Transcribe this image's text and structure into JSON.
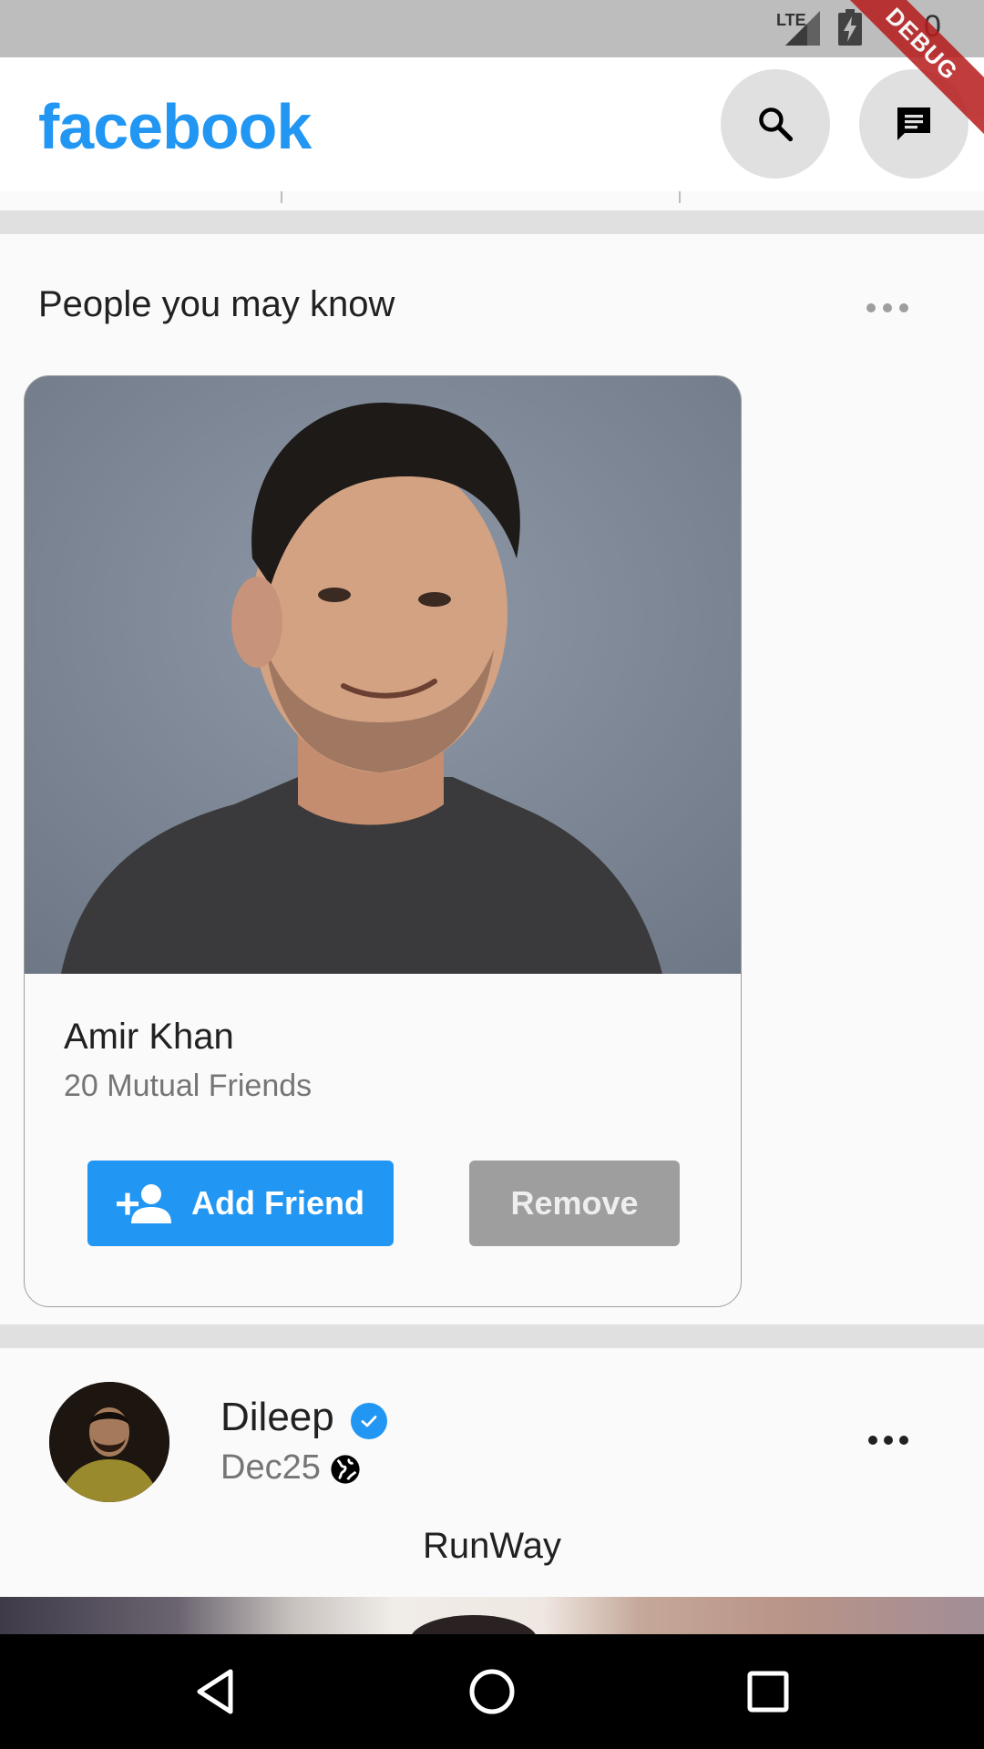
{
  "status_bar": {
    "network": "LTE",
    "time": "0"
  },
  "debug_banner": "DEBUG",
  "app_bar": {
    "logo": "facebook",
    "search_icon": "search-icon",
    "messenger_icon": "messenger-icon"
  },
  "people_you_may_know": {
    "title": "People you may know",
    "more_icon": "more-horizontal-icon",
    "card": {
      "name": "Amir Khan",
      "mutual_friends": "20 Mutual Friends",
      "add_friend_label": "Add Friend",
      "add_friend_icon": "person-add-icon",
      "remove_label": "Remove"
    }
  },
  "post": {
    "author": "Dileep",
    "verified_icon": "verified-icon",
    "date": "Dec25",
    "privacy_icon": "globe-icon",
    "more_icon": "more-horizontal-icon",
    "text": "RunWay"
  },
  "nav_bar": {
    "back_icon": "back-triangle-icon",
    "home_icon": "home-circle-icon",
    "recents_icon": "recents-square-icon"
  },
  "colors": {
    "brand": "#2196f3",
    "status_bar": "#bdbdbd",
    "remove_button": "#9e9e9e",
    "separator": "#e0e0e0"
  }
}
